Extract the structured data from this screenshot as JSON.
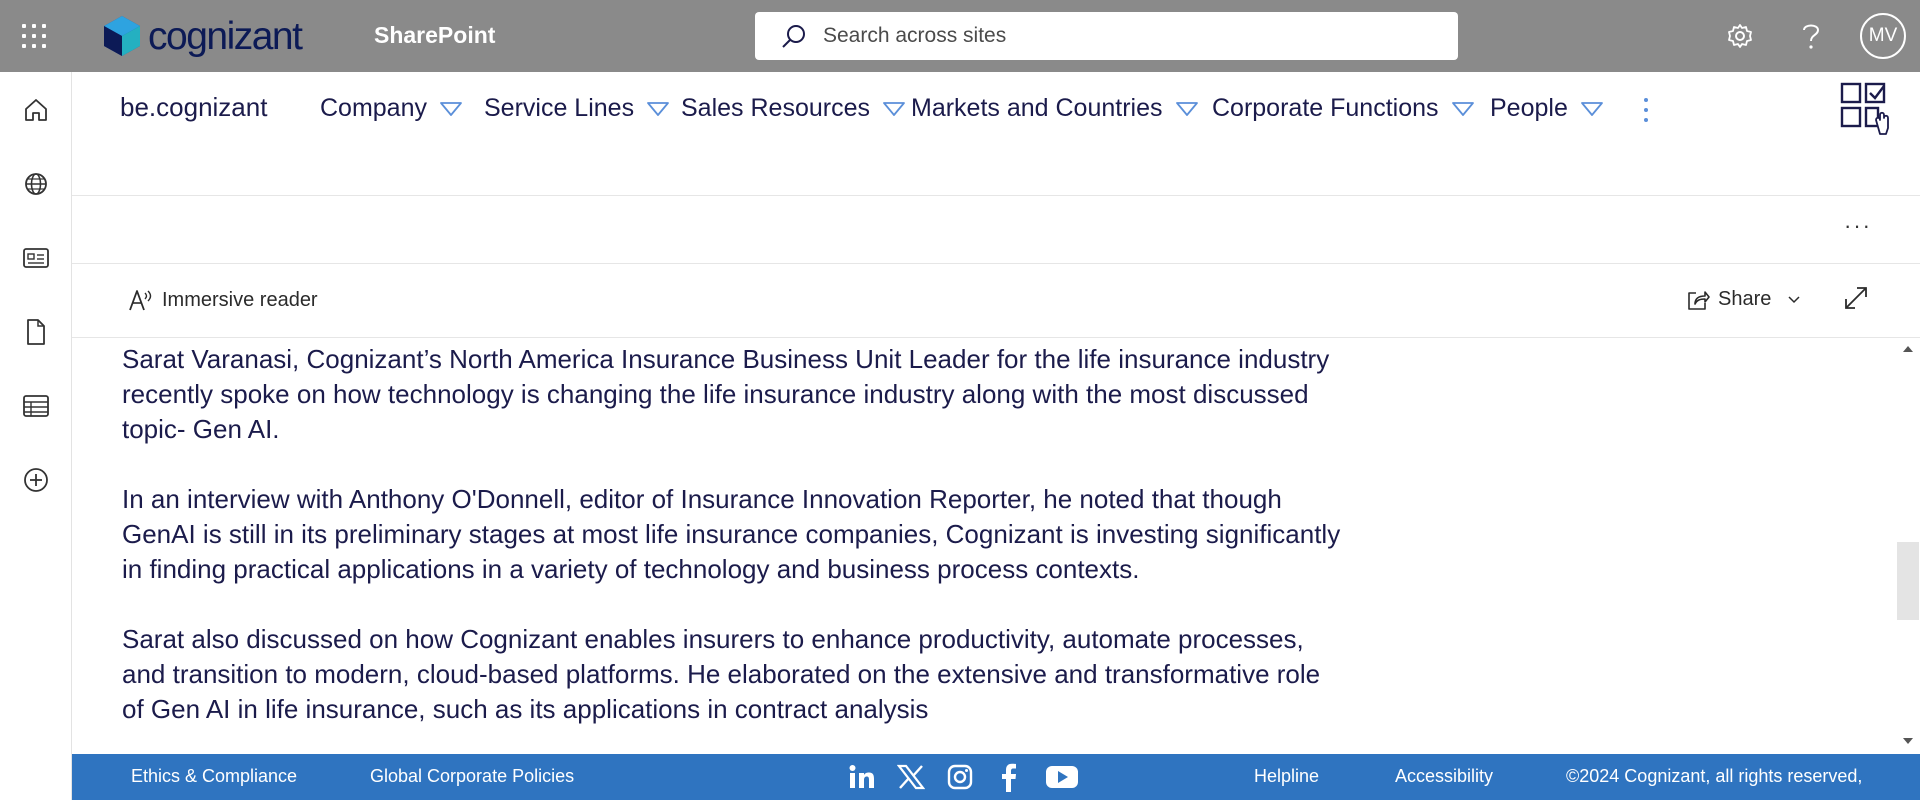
{
  "suite_bar": {
    "brand": "cognizant",
    "app_name": "SharePoint",
    "search_placeholder": "Search across sites",
    "avatar_initials": "MV",
    "color": "#8a8a8a"
  },
  "hub_nav": {
    "site_title": "be.cognizant",
    "items": [
      {
        "label": "Company"
      },
      {
        "label": "Service Lines"
      },
      {
        "label": "Sales Resources"
      },
      {
        "label": "Markets and Countries"
      },
      {
        "label": "Corporate Functions"
      },
      {
        "label": "People"
      }
    ]
  },
  "toolbar": {
    "immersive_reader": "Immersive reader",
    "share": "Share"
  },
  "article": {
    "paragraphs": [
      "Sarat Varanasi, Cognizant’s North America Insurance Business Unit Leader for the life insurance industry recently spoke on how technology is changing the life insurance industry along with the most discussed topic- Gen AI.",
      "In an interview with Anthony O'Donnell, editor of Insurance Innovation Reporter, he noted that though GenAI is still in its preliminary stages at most life insurance companies, Cognizant is investing significantly in finding practical applications in a variety of technology and business process contexts.",
      "Sarat also discussed on how Cognizant enables insurers to enhance productivity, automate processes, and transition to modern, cloud-based platforms. He elaborated on the extensive and transformative role of Gen AI in life insurance, such as its applications in contract analysis"
    ]
  },
  "footer": {
    "links_left": [
      "Ethics & Compliance",
      "Global Corporate Policies"
    ],
    "social": [
      "linkedin-icon",
      "x-icon",
      "instagram-icon",
      "facebook-icon",
      "youtube-icon"
    ],
    "helpline": "Helpline",
    "accessibility": "Accessibility",
    "copyright": "©2024 Cognizant, all rights reserved,",
    "color": "#2f74c0"
  },
  "colors": {
    "text": "#1b1b4b",
    "accent": "#5b8fd9"
  }
}
